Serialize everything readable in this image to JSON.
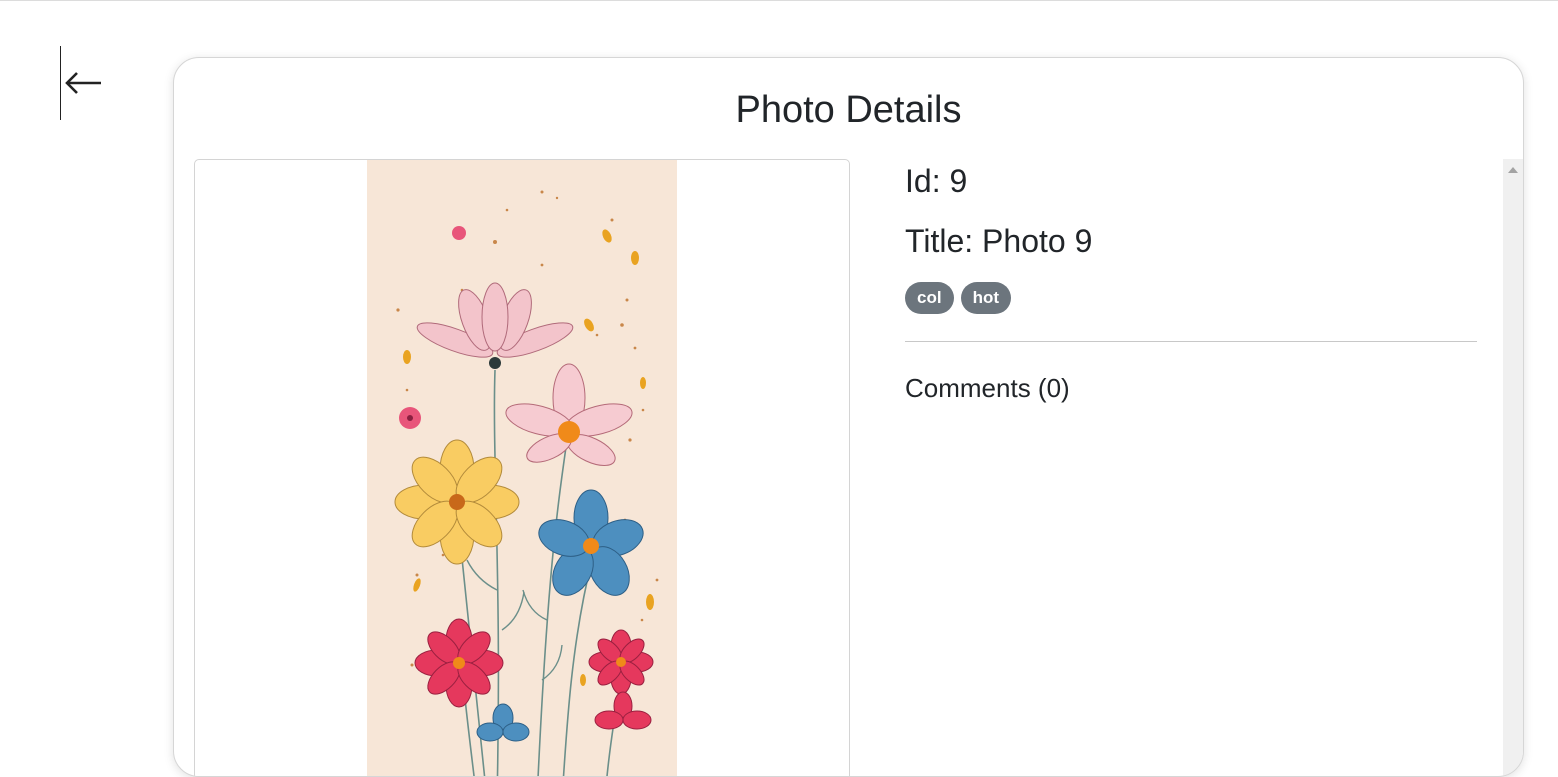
{
  "nav": {
    "back_icon": "arrow-left-icon"
  },
  "card": {
    "title": "Photo Details"
  },
  "photo": {
    "id_line": "Id: 9",
    "title_line": "Title: Photo 9",
    "tags": [
      "col",
      "hot"
    ]
  },
  "comments": {
    "heading": "Comments (0)"
  },
  "colors": {
    "tag_bg": "#6c757d",
    "text": "#212529",
    "photo_bg": "#f7e6d6"
  }
}
